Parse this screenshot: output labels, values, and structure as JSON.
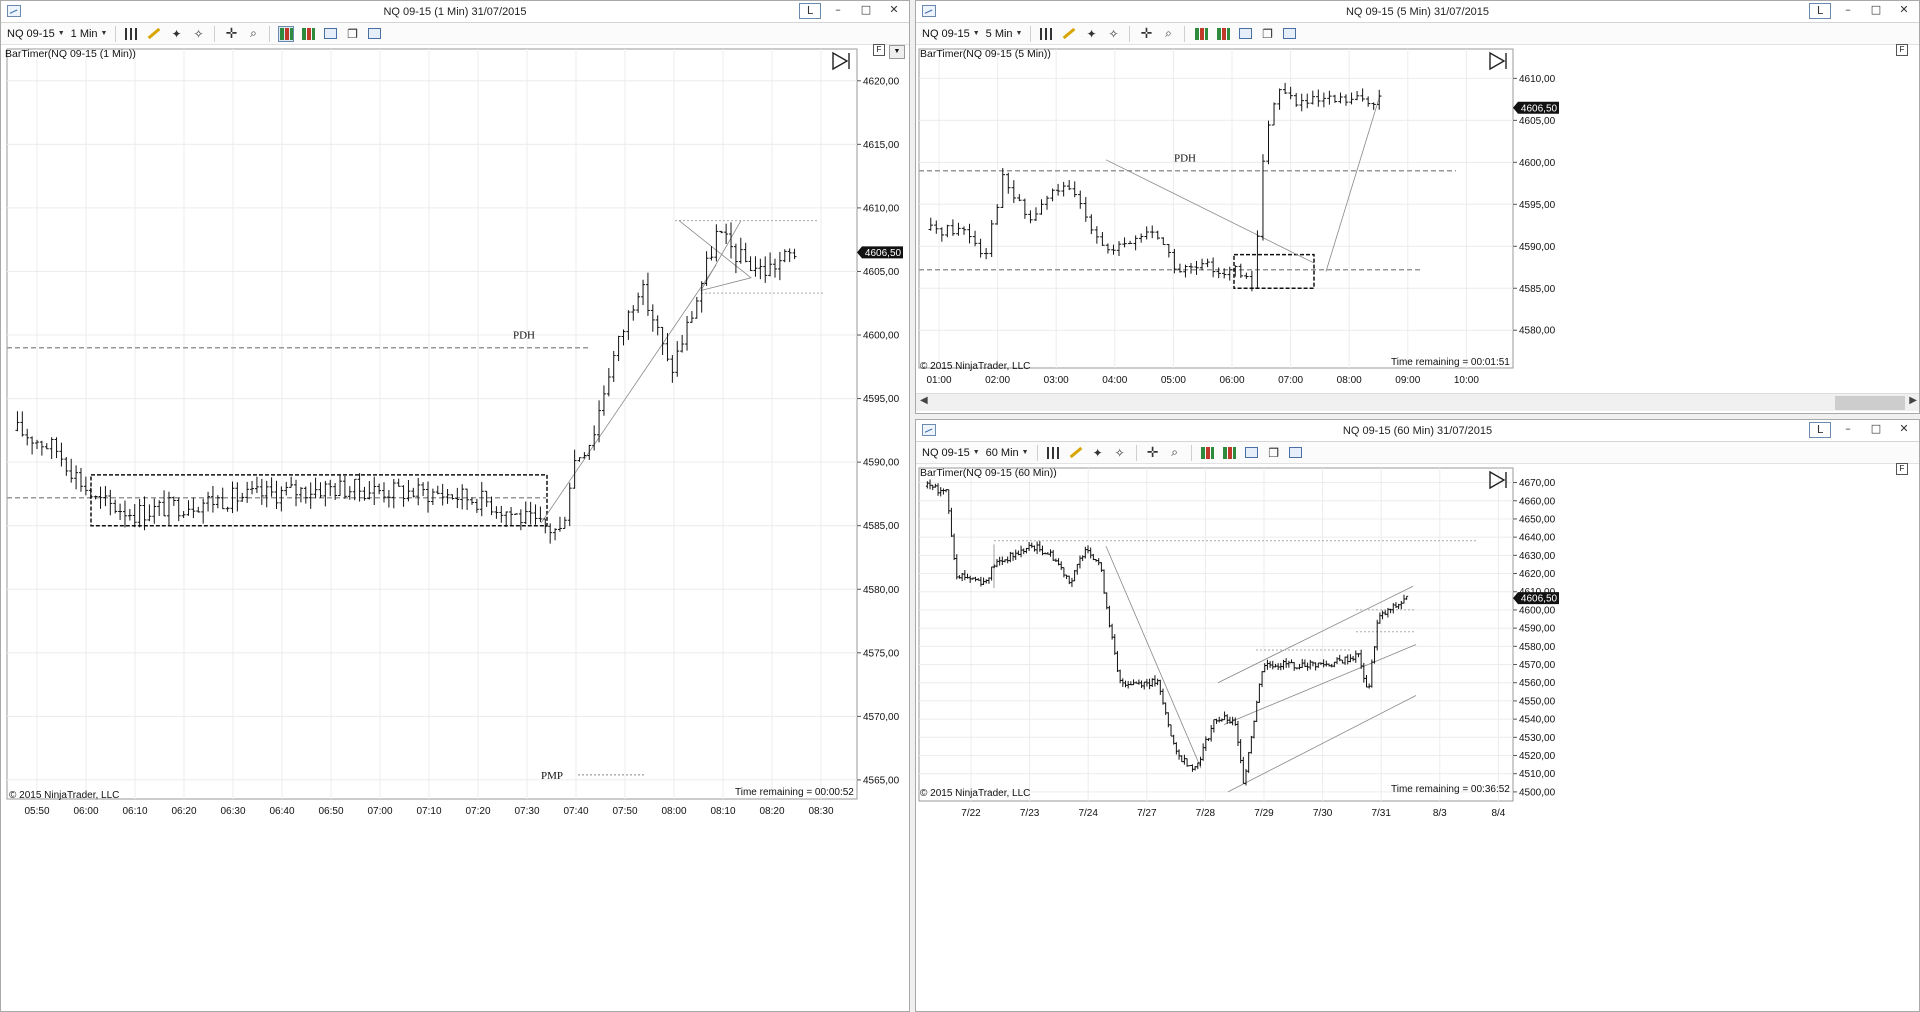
{
  "toolbar": {
    "instrument": "NQ 09-15",
    "timeframes": {
      "w1": "1 Min",
      "w2": "5 Min",
      "w3": "60 Min"
    }
  },
  "windows": {
    "w1": {
      "title": "NQ 09-15 (1 Min)  31/07/2015",
      "indicator": "BarTimer(NQ 09-15 (1 Min))",
      "time_remaining": "Time remaining = 00:00:52",
      "copyright": "© 2015 NinjaTrader, LLC",
      "price_marker": "4606,50",
      "pdh_label": "PDH",
      "pmp_label": "PMP"
    },
    "w2": {
      "title": "NQ 09-15 (5 Min)  31/07/2015",
      "indicator": "BarTimer(NQ 09-15 (5 Min))",
      "time_remaining": "Time remaining = 00:01:51",
      "copyright": "© 2015 NinjaTrader, LLC",
      "price_marker": "4606,50",
      "pdh_label": "PDH"
    },
    "w3": {
      "title": "NQ 09-15 (60 Min)  31/07/2015",
      "indicator": "BarTimer(NQ 09-15 (60 Min))",
      "time_remaining": "Time remaining = 00:36:52",
      "copyright": "© 2015 NinjaTrader, LLC",
      "price_marker": "4606,50"
    }
  },
  "window_buttons": {
    "link": "L",
    "minimize": "–",
    "maximize": "□",
    "close": "✕"
  },
  "chart_data": [
    {
      "type": "ohlc",
      "window": "w1",
      "x_ticks": [
        "05:50",
        "06:00",
        "06:10",
        "06:20",
        "06:30",
        "06:40",
        "06:50",
        "07:00",
        "07:10",
        "07:20",
        "07:30",
        "07:40",
        "07:50",
        "08:00",
        "08:10",
        "08:20",
        "08:30"
      ],
      "y_ticks": [
        "4620,00",
        "4615,00",
        "4610,00",
        "4605,00",
        "4600,00",
        "4595,00",
        "4590,00",
        "4585,00",
        "4580,00",
        "4575,00",
        "4570,00",
        "4565,00"
      ],
      "ylim": [
        4563.5,
        4622.5
      ],
      "pdh": 4599.0,
      "range_box": {
        "top": 4589.0,
        "bottom": 4585.0
      },
      "close": 4606.5,
      "pmp": 4565.4
    },
    {
      "type": "ohlc",
      "window": "w2",
      "x_ticks": [
        "01:00",
        "02:00",
        "03:00",
        "04:00",
        "05:00",
        "06:00",
        "07:00",
        "08:00",
        "09:00",
        "10:00"
      ],
      "y_ticks": [
        "4610,00",
        "4605,00",
        "4600,00",
        "4595,00",
        "4590,00",
        "4585,00",
        "4580,00"
      ],
      "ylim": [
        4575.5,
        4613.5
      ],
      "pdh": 4599.0,
      "range_box": {
        "top": 4589.0,
        "bottom": 4585.0
      },
      "close": 4606.5
    },
    {
      "type": "ohlc",
      "window": "w3",
      "x_ticks": [
        "7/22",
        "7/23",
        "7/24",
        "7/27",
        "7/28",
        "7/29",
        "7/30",
        "7/31",
        "8/3",
        "8/4"
      ],
      "y_ticks": [
        "4670,00",
        "4660,00",
        "4650,00",
        "4640,00",
        "4630,00",
        "4620,00",
        "4610,00",
        "4600,00",
        "4590,00",
        "4580,00",
        "4570,00",
        "4560,00",
        "4550,00",
        "4540,00",
        "4530,00",
        "4520,00",
        "4510,00",
        "4500,00"
      ],
      "ylim": [
        4495,
        4678
      ],
      "close": 4606.5
    }
  ]
}
